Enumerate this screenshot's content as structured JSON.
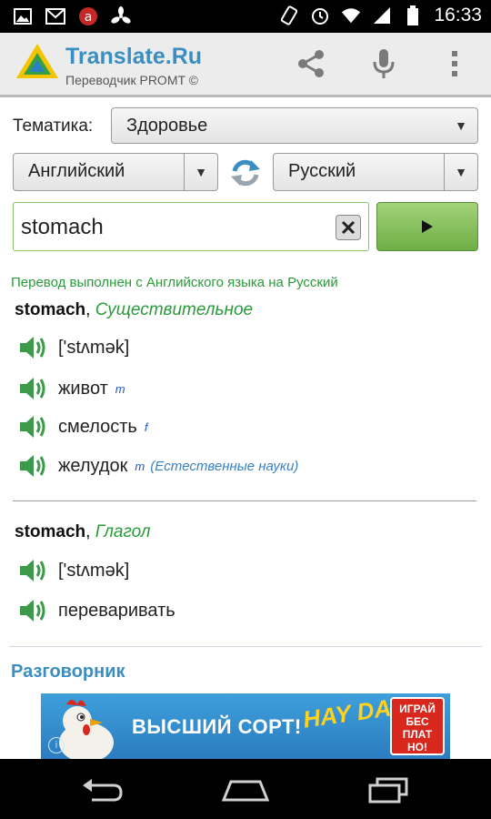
{
  "status_bar": {
    "time": "16:33",
    "left_icons": [
      "image-icon",
      "gmail-icon",
      "avito-icon",
      "fan-icon"
    ],
    "right_icons": [
      "rotate-icon",
      "alarm-icon",
      "wifi-icon",
      "signal-icon",
      "battery-icon"
    ]
  },
  "app_bar": {
    "title": "Translate.Ru",
    "subtitle": "Переводчик PROMT ©",
    "actions": [
      "share-icon",
      "microphone-icon",
      "overflow-menu-icon"
    ]
  },
  "topic": {
    "label": "Тематика:",
    "value": "Здоровье"
  },
  "languages": {
    "source": "Английский",
    "target": "Русский"
  },
  "search": {
    "value": "stomach"
  },
  "result_status": "Перевод выполнен с Английского языка на Русский",
  "entries": [
    {
      "word": "stomach",
      "sep": ",",
      "pos": "Существительное",
      "rows": [
        {
          "text": "['stʌmək]",
          "gender": "",
          "domain": ""
        },
        {
          "text": "живот",
          "gender": "m",
          "domain": ""
        },
        {
          "text": "смелость",
          "gender": "f",
          "domain": ""
        },
        {
          "text": "желудок",
          "gender": "m",
          "domain": "(Естественные науки)"
        }
      ]
    },
    {
      "word": "stomach",
      "sep": ",",
      "pos": "Глагол",
      "rows": [
        {
          "text": "['stʌmək]",
          "gender": "",
          "domain": ""
        },
        {
          "text": "переваривать",
          "gender": "",
          "domain": ""
        }
      ]
    }
  ],
  "phrasebook_title": "Разговорник",
  "banner": {
    "text": "ВЫСШИЙ СОРТ!",
    "logo": "HAY DAY",
    "badge": "ИГРАЙ БЕС ПЛАТ НО!",
    "info": "i"
  },
  "nav_bar": [
    "back-icon",
    "home-icon",
    "recent-apps-icon"
  ],
  "colors": {
    "accent_blue": "#3a8ec2",
    "accent_green": "#2a9a3a",
    "go_button": "#7fbb52"
  }
}
